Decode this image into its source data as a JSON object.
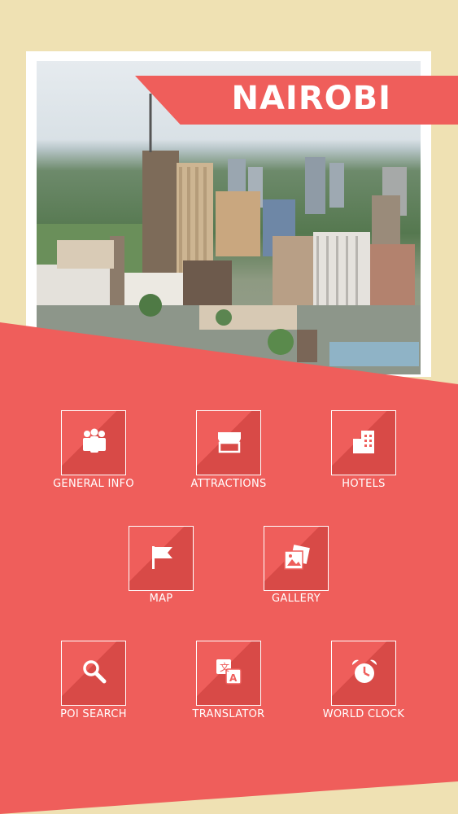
{
  "header": {
    "city": "NAIROBI"
  },
  "menu": [
    {
      "label": "GENERAL INFO",
      "icon": "people-icon"
    },
    {
      "label": "ATTRACTIONS",
      "icon": "store-icon"
    },
    {
      "label": "HOTELS",
      "icon": "building-icon"
    },
    {
      "label": "MAP",
      "icon": "flag-icon"
    },
    {
      "label": "GALLERY",
      "icon": "photos-icon"
    },
    {
      "label": "POI SEARCH",
      "icon": "search-icon"
    },
    {
      "label": "TRANSLATOR",
      "icon": "translate-icon"
    },
    {
      "label": "WORLD CLOCK",
      "icon": "alarm-clock-icon"
    }
  ],
  "colors": {
    "accent": "#ef5e5b",
    "background": "#efe1b3"
  }
}
